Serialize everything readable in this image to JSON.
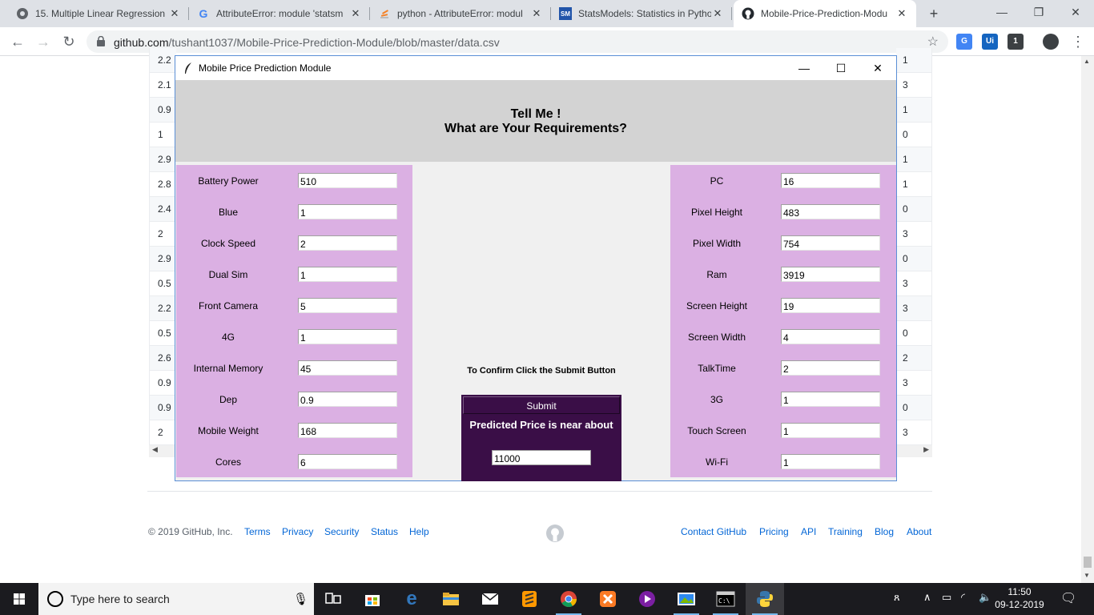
{
  "browser": {
    "tabs": [
      {
        "title": "15. Multiple Linear Regression",
        "icon": "chrome-tab-icon"
      },
      {
        "title": "AttributeError: module 'statsm",
        "icon": "google-icon"
      },
      {
        "title": "python - AttributeError: modul",
        "icon": "stackoverflow-icon"
      },
      {
        "title": "StatsModels: Statistics in Pytho",
        "icon": "statsmodels-icon",
        "icon_text": "SM"
      },
      {
        "title": "Mobile-Price-Prediction-Modu",
        "icon": "github-icon"
      }
    ],
    "url_host": "github.com",
    "url_path": "/tushant1037/Mobile-Price-Prediction-Module/blob/master/data.csv",
    "extensions": [
      {
        "name": "translate-extension-icon",
        "text": "G",
        "color": "#4285f4"
      },
      {
        "name": "uipath-extension-icon",
        "text": "Ui",
        "color": "#1565c0"
      },
      {
        "name": "package-extension-icon",
        "text": "1",
        "color": "#3c4043"
      },
      {
        "name": "profile-avatar-icon",
        "text": "",
        "color": "#3c4043"
      }
    ]
  },
  "github": {
    "left_column": [
      "2.2",
      "2.1",
      "0.9",
      "1",
      "2.9",
      "2.8",
      "2.4",
      "2",
      "2.9",
      "0.5",
      "2.2",
      "0.5",
      "2.6",
      "0.9",
      "0.9",
      "2"
    ],
    "right_column": [
      "1",
      "3",
      "1",
      "0",
      "1",
      "1",
      "0",
      "3",
      "0",
      "3",
      "3",
      "0",
      "2",
      "3",
      "0",
      "3"
    ],
    "footer": {
      "copyright": "© 2019 GitHub, Inc.",
      "left_links": [
        "Terms",
        "Privacy",
        "Security",
        "Status",
        "Help"
      ],
      "right_links": [
        "Contact GitHub",
        "Pricing",
        "API",
        "Training",
        "Blog",
        "About"
      ]
    }
  },
  "app": {
    "window_title": "Mobile Price Prediction Module",
    "heading_line1": "Tell Me !",
    "heading_line2": "What are Your Requirements?",
    "left_fields": [
      {
        "label": "Battery Power",
        "value": "510"
      },
      {
        "label": "Blue",
        "value": "1"
      },
      {
        "label": "Clock Speed",
        "value": "2"
      },
      {
        "label": "Dual Sim",
        "value": "1"
      },
      {
        "label": "Front Camera",
        "value": "5"
      },
      {
        "label": "4G",
        "value": "1"
      },
      {
        "label": "Internal Memory",
        "value": "45"
      },
      {
        "label": "Dep",
        "value": "0.9"
      },
      {
        "label": "Mobile Weight",
        "value": "168"
      },
      {
        "label": "Cores",
        "value": "6"
      }
    ],
    "right_fields": [
      {
        "label": "PC",
        "value": "16"
      },
      {
        "label": "Pixel Height",
        "value": "483"
      },
      {
        "label": "Pixel Width",
        "value": "754"
      },
      {
        "label": "Ram",
        "value": "3919"
      },
      {
        "label": "Screen Height",
        "value": "19"
      },
      {
        "label": "Screen Width",
        "value": "4"
      },
      {
        "label": "TalkTime",
        "value": "2"
      },
      {
        "label": "3G",
        "value": "1"
      },
      {
        "label": "Touch Screen",
        "value": "1"
      },
      {
        "label": "Wi-Fi",
        "value": "1"
      }
    ],
    "confirm_text": "To Confirm Click the Submit Button",
    "submit_label": "Submit",
    "predicted_label": "Predicted Price is near about",
    "predicted_value": "11000",
    "colors": {
      "panel": "#dbb0e3",
      "header": "#d3d3d3",
      "result_bg": "#3a0e47"
    }
  },
  "taskbar": {
    "search_placeholder": "Type here to search",
    "apps": [
      "task-view-icon",
      "store-icon",
      "edge-icon",
      "file-explorer-icon",
      "mail-icon",
      "sublime-icon",
      "chrome-icon",
      "xampp-icon",
      "media-icon",
      "photos-icon",
      "terminal-icon",
      "python-icon"
    ],
    "time": "11:50",
    "date": "09-12-2019"
  }
}
